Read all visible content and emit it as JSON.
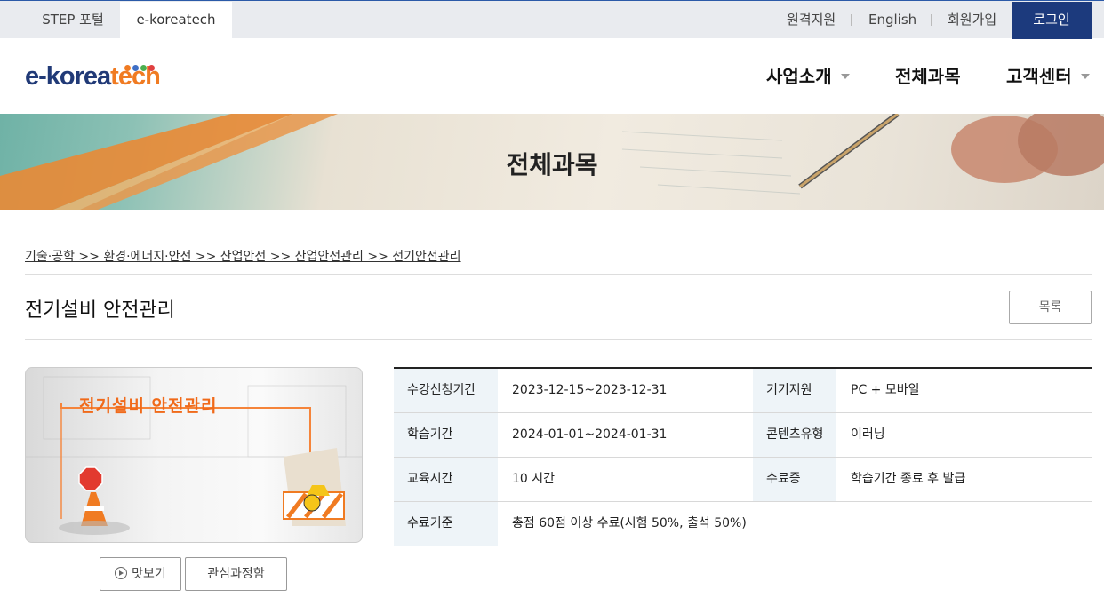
{
  "topbar": {
    "tabs": [
      {
        "label": "STEP 포털"
      },
      {
        "label": "e-koreatech"
      }
    ],
    "links": [
      "원격지원",
      "English",
      "회원가입"
    ],
    "login_label": "로그인"
  },
  "logo": {
    "text_main": "e-korea",
    "text_accent": "tech",
    "dot_colors": [
      "#f07b22",
      "#3f6fc6",
      "#4caf50",
      "#e04040"
    ]
  },
  "nav": [
    {
      "label": "사업소개",
      "has_caret": true
    },
    {
      "label": "전체과목",
      "has_caret": false
    },
    {
      "label": "고객센터",
      "has_caret": true
    }
  ],
  "banner": {
    "title": "전체과목"
  },
  "breadcrumb": "기술·공학 >> 환경·에너지·안전 >> 산업안전 >> 산업안전관리 >> 전기안전관리",
  "course": {
    "title": "전기설비 안전관리",
    "list_button": "목록",
    "thumbnail_title": "전기설비 안전관리",
    "preview_button": "맛보기",
    "wishlist_button": "관심과정함"
  },
  "info": {
    "rows": [
      {
        "h1": "수강신청기간",
        "v1": "2023-12-15~2023-12-31",
        "h2": "기기지원",
        "v2": "PC + 모바일"
      },
      {
        "h1": "학습기간",
        "v1": "2024-01-01~2024-01-31",
        "h2": "콘텐츠유형",
        "v2": "이러닝"
      },
      {
        "h1": "교육시간",
        "v1": "10 시간",
        "h2": "수료증",
        "v2": "학습기간 종료 후 발급"
      },
      {
        "h1": "수료기준",
        "v1": "총점 60점 이상 수료(시험 50%, 출석 50%)",
        "h2": "",
        "v2": ""
      }
    ]
  },
  "colors": {
    "brand_navy": "#1c3a7d",
    "brand_orange": "#f07b22",
    "table_header_bg": "#eef4f8"
  }
}
